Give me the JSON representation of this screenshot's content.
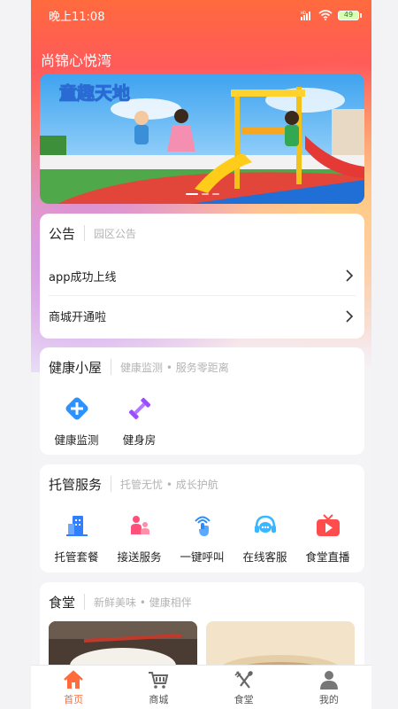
{
  "status_bar": {
    "time": "晚上11:08",
    "battery": "49"
  },
  "app_title": "尚锦心悦湾",
  "banner": {
    "caption": "童趣天地"
  },
  "notice": {
    "title": "公告",
    "subtitle": "园区公告",
    "items": [
      {
        "label": "app成功上线"
      },
      {
        "label": "商城开通啦"
      }
    ]
  },
  "health": {
    "title": "健康小屋",
    "subtitle": "健康监测 • 服务零距离",
    "items": [
      {
        "label": "健康监测",
        "icon": "plus-diamond-icon",
        "color": "#2a93ff"
      },
      {
        "label": "健身房",
        "icon": "dumbbell-icon",
        "color": "#9b4dff"
      }
    ]
  },
  "care": {
    "title": "托管服务",
    "subtitle": "托管无忧 • 成长护航",
    "items": [
      {
        "label": "托管套餐",
        "icon": "building-icon",
        "color": "#2f7fff"
      },
      {
        "label": "接送服务",
        "icon": "parent-child-icon",
        "color": "#ff4f7a"
      },
      {
        "label": "一键呼叫",
        "icon": "tap-call-icon",
        "color": "#2a8cff"
      },
      {
        "label": "在线客服",
        "icon": "headset-icon",
        "color": "#38b6ff"
      },
      {
        "label": "食堂直播",
        "icon": "tv-play-icon",
        "color": "#ff4d4d"
      }
    ]
  },
  "canteen": {
    "title": "食堂",
    "subtitle": "新鲜美味 • 健康相伴"
  },
  "tabbar": {
    "items": [
      {
        "label": "首页",
        "icon": "home-icon",
        "active": true
      },
      {
        "label": "商城",
        "icon": "cart-icon",
        "active": false
      },
      {
        "label": "食堂",
        "icon": "utensils-icon",
        "active": false
      },
      {
        "label": "我的",
        "icon": "user-icon",
        "active": false
      }
    ]
  },
  "colors": {
    "accent": "#ff6b3a",
    "hero_top": "#ff5a5a"
  }
}
